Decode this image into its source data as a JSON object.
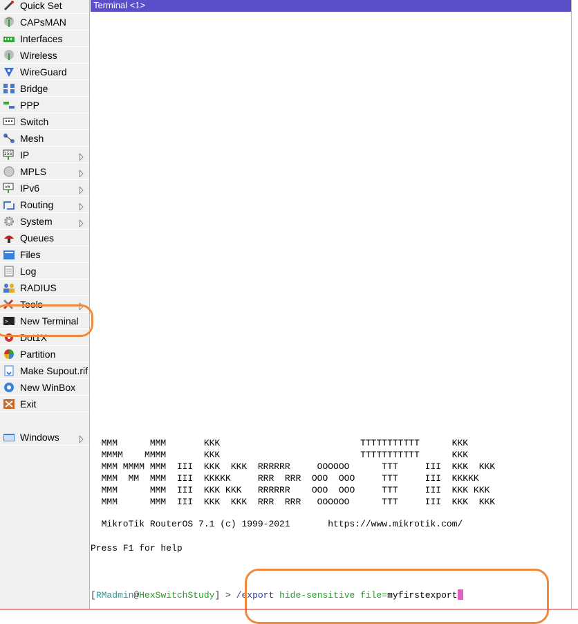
{
  "sidebar": {
    "items": [
      {
        "label": "Quick Set",
        "icon": "wand-icon",
        "name": "quick-set",
        "submenu": false
      },
      {
        "label": "CAPsMAN",
        "icon": "antenna-icon",
        "name": "capsman",
        "submenu": false
      },
      {
        "label": "Interfaces",
        "icon": "interfaces-icon",
        "name": "interfaces",
        "submenu": false
      },
      {
        "label": "Wireless",
        "icon": "wireless-icon",
        "name": "wireless",
        "submenu": false
      },
      {
        "label": "WireGuard",
        "icon": "wireguard-icon",
        "name": "wireguard",
        "submenu": false
      },
      {
        "label": "Bridge",
        "icon": "bridge-icon",
        "name": "bridge",
        "submenu": false
      },
      {
        "label": "PPP",
        "icon": "ppp-icon",
        "name": "ppp",
        "submenu": false
      },
      {
        "label": "Switch",
        "icon": "switch-icon",
        "name": "switch",
        "submenu": false
      },
      {
        "label": "Mesh",
        "icon": "mesh-icon",
        "name": "mesh",
        "submenu": false
      },
      {
        "label": "IP",
        "icon": "ip-icon",
        "name": "ip",
        "submenu": true
      },
      {
        "label": "MPLS",
        "icon": "mpls-icon",
        "name": "mpls",
        "submenu": true
      },
      {
        "label": "IPv6",
        "icon": "ipv6-icon",
        "name": "ipv6",
        "submenu": true
      },
      {
        "label": "Routing",
        "icon": "routing-icon",
        "name": "routing",
        "submenu": true
      },
      {
        "label": "System",
        "icon": "system-gear-icon",
        "name": "system",
        "submenu": true
      },
      {
        "label": "Queues",
        "icon": "queues-icon",
        "name": "queues",
        "submenu": false
      },
      {
        "label": "Files",
        "icon": "folder-icon",
        "name": "files",
        "submenu": false
      },
      {
        "label": "Log",
        "icon": "log-icon",
        "name": "log",
        "submenu": false
      },
      {
        "label": "RADIUS",
        "icon": "radius-users-icon",
        "name": "radius",
        "submenu": false
      },
      {
        "label": "Tools",
        "icon": "tools-icon",
        "name": "tools",
        "submenu": true
      },
      {
        "label": "New Terminal",
        "icon": "terminal-icon",
        "name": "new-terminal",
        "submenu": false
      },
      {
        "label": "Dot1X",
        "icon": "dot1x-icon",
        "name": "dot1x",
        "submenu": false
      },
      {
        "label": "Partition",
        "icon": "partition-icon",
        "name": "partition",
        "submenu": false
      },
      {
        "label": "Make Supout.rif",
        "icon": "supout-icon",
        "name": "make-supout",
        "submenu": false
      },
      {
        "label": "New WinBox",
        "icon": "winbox-icon",
        "name": "new-winbox",
        "submenu": false
      },
      {
        "label": "Exit",
        "icon": "exit-icon",
        "name": "exit",
        "submenu": false
      },
      {
        "label": "Windows",
        "icon": "windows-icon",
        "name": "windows",
        "submenu": true
      }
    ]
  },
  "terminal": {
    "title": "Terminal <1>",
    "logo_lines": [
      "  MMM      MMM       KKK                          TTTTTTTTTTT      KKK",
      "  MMMM    MMMM       KKK                          TTTTTTTTTTT      KKK",
      "  MMM MMMM MMM  III  KKK  KKK  RRRRRR     OOOOOO      TTT     III  KKK  KKK",
      "  MMM  MM  MMM  III  KKKKK     RRR  RRR  OOO  OOO     TTT     III  KKKKK",
      "  MMM      MMM  III  KKK KKK   RRRRRR    OOO  OOO     TTT     III  KKK KKK",
      "  MMM      MMM  III  KKK  KKK  RRR  RRR   OOOOOO      TTT     III  KKK  KKK"
    ],
    "brand_line": "  MikroTik RouterOS 7.1 (c) 1999-2021       https://www.mikrotik.com/",
    "help_line": "Press F1 for help",
    "prompt": {
      "open_bracket": "[",
      "user": "RMadmin",
      "at": "@",
      "host": "HexSwitchStudy",
      "close": "] > ",
      "path": "/export",
      "command": " hide-sensitive file=",
      "argument": "myfirstexport"
    }
  },
  "colors": {
    "title_bar": "#5a4fc8",
    "highlight": "#f08a3a",
    "cursor": "#e060c0"
  }
}
